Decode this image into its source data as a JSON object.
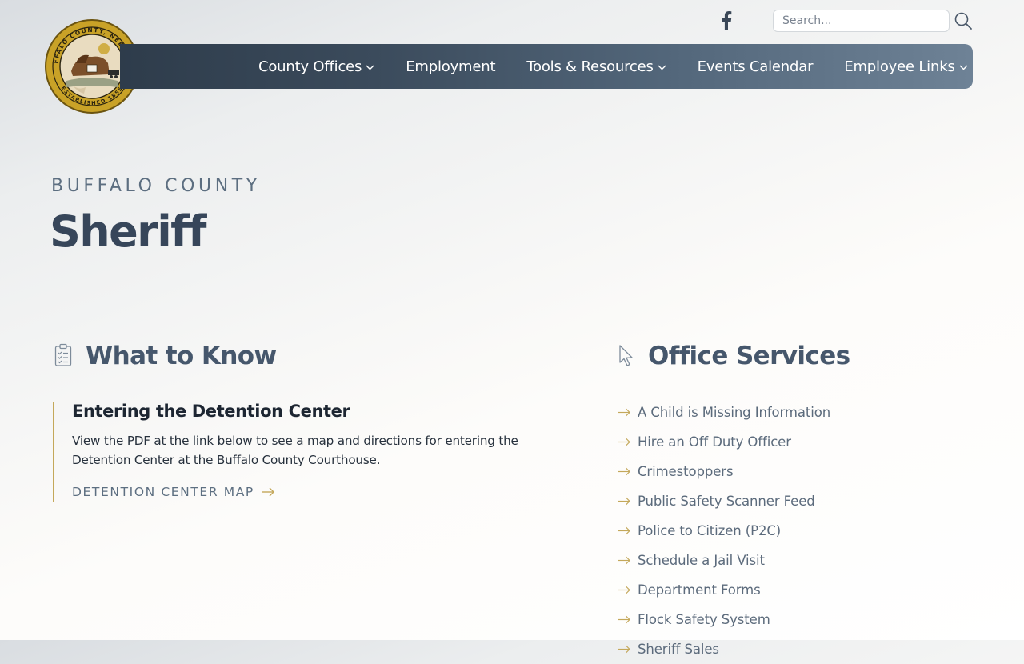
{
  "header": {
    "seal": {
      "icon": "county-seal-icon",
      "ring_text": "BUFFALO COUNTY, NEBRASKA",
      "established_text": "ESTABLISHED 1855"
    },
    "facebook_icon": "facebook-icon",
    "search": {
      "placeholder": "Search...",
      "icon": "search-icon"
    },
    "nav": [
      {
        "label": "County Offices",
        "has_dropdown": true
      },
      {
        "label": "Employment",
        "has_dropdown": false
      },
      {
        "label": "Tools & Resources",
        "has_dropdown": true
      },
      {
        "label": "Events Calendar",
        "has_dropdown": false
      },
      {
        "label": "Employee Links",
        "has_dropdown": true
      }
    ]
  },
  "hero": {
    "kicker": "BUFFALO COUNTY",
    "title": "Sheriff"
  },
  "what_to_know": {
    "heading": "What to Know",
    "icon": "clipboard-checklist-icon",
    "card": {
      "title": "Entering the Detention Center",
      "text": "View the PDF at the link below to see a map and directions for entering the Detention Center at the Buffalo County Courthouse.",
      "link_label": "DETENTION CENTER MAP",
      "link_icon": "arrow-right-icon"
    }
  },
  "office_services": {
    "heading": "Office Services",
    "icon": "cursor-pointer-icon",
    "items": [
      {
        "label": "A Child is Missing Information"
      },
      {
        "label": "Hire an Off Duty Officer"
      },
      {
        "label": "Crimestoppers"
      },
      {
        "label": "Public Safety Scanner Feed"
      },
      {
        "label": "Police to Citizen (P2C)"
      },
      {
        "label": "Schedule a Jail Visit"
      },
      {
        "label": "Department Forms"
      },
      {
        "label": "Flock Safety System"
      },
      {
        "label": "Sheriff Sales"
      }
    ]
  },
  "colors": {
    "nav_gradient_start": "#2e3c4b",
    "nav_gradient_end": "#6e8296",
    "accent_gold": "#c4a85a",
    "heading": "#46576c",
    "text_dark": "#1d2632",
    "link_muted": "#5d6f81"
  }
}
